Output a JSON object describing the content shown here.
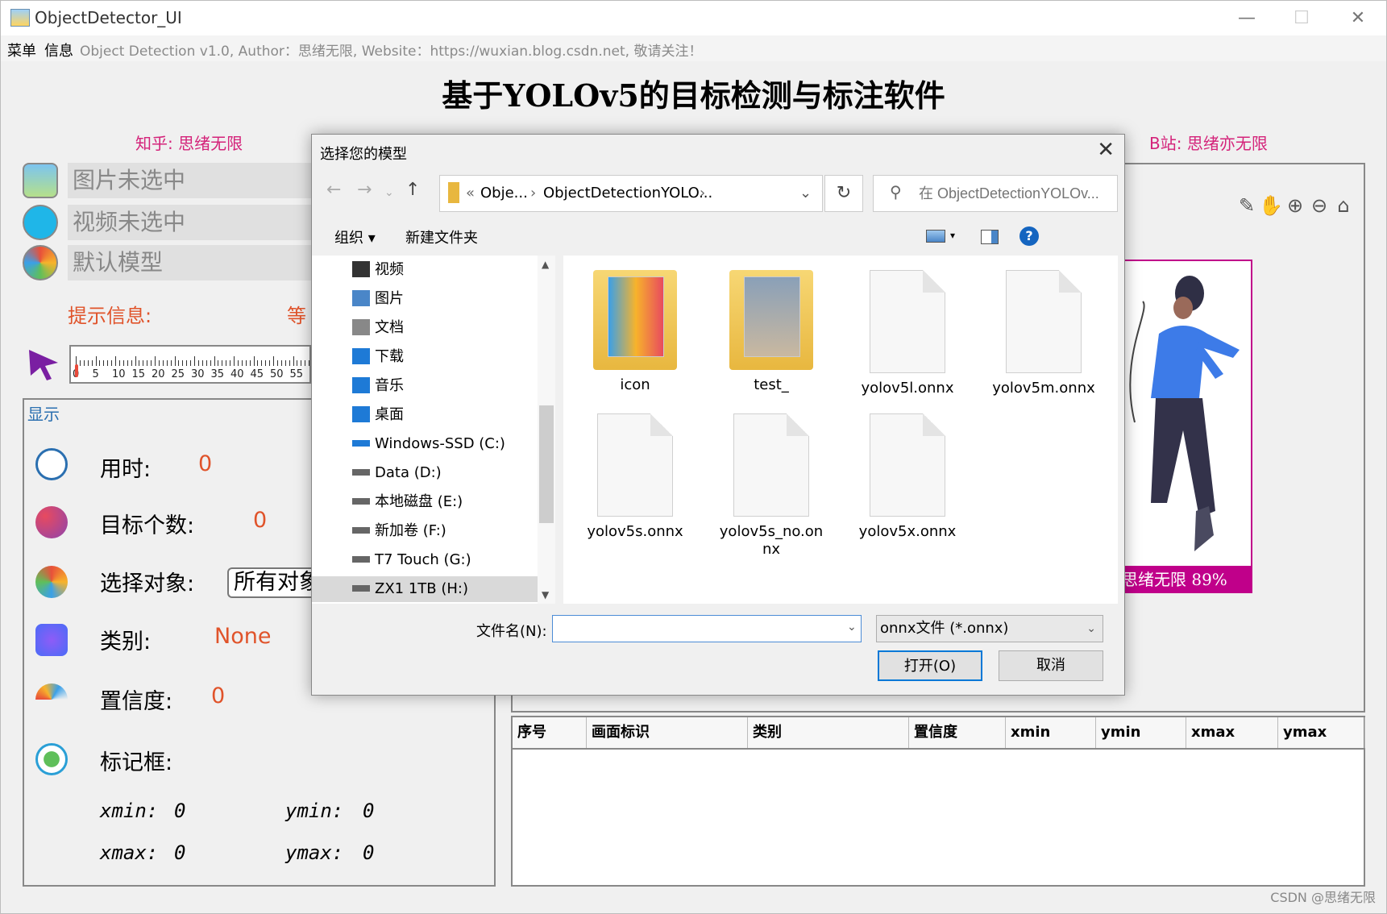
{
  "window": {
    "title": "ObjectDetector_UI",
    "controls": {
      "minimize": "—",
      "maximize": "☐",
      "close": "✕"
    }
  },
  "menubar": {
    "items": [
      "菜单",
      "信息"
    ],
    "info": "Object Detection v1.0, Author：思绪无限, Website：https://wuxian.blog.csdn.net, 敬请关注！"
  },
  "header": {
    "title": "基于YOLOv5的目标检测与标注软件",
    "zhihu": "知乎: 思绪无限",
    "bilibili": "B站: 思绪亦无限"
  },
  "left": {
    "image_status": "图片未选中",
    "video_status": "视频未选中",
    "model_status": "默认模型",
    "hint_label": "提示信息:",
    "hint_value": "等",
    "slider_ticks": [
      "0",
      "5",
      "10",
      "15",
      "20",
      "25",
      "30",
      "35",
      "40",
      "45",
      "50",
      "55"
    ],
    "display_label": "显示",
    "time_label": "用时:",
    "time_value": "0",
    "count_label": "目标个数:",
    "count_value": "0",
    "select_label": "选择对象:",
    "select_value": "所有对象",
    "class_label": "类别:",
    "class_value": "None",
    "conf_label": "置信度:",
    "conf_value": "0",
    "box_label": "标记框:",
    "xmin_label": "xmin:",
    "xmin_value": "0",
    "ymin_label": "ymin:",
    "ymin_value": "0",
    "xmax_label": "xmax:",
    "xmax_value": "0",
    "ymax_label": "ymax:",
    "ymax_value": "0"
  },
  "right": {
    "detection_label": "思绪无限  89%",
    "table_headers": [
      "序号",
      "画面标识",
      "类别",
      "置信度",
      "xmin",
      "ymin",
      "xmax",
      "ymax"
    ],
    "toolbar_icons": [
      "edit-icon",
      "hand-icon",
      "zoom-in-icon",
      "zoom-out-icon",
      "home-icon"
    ]
  },
  "dialog": {
    "title": "选择您的模型",
    "path": [
      "«",
      "Obje...",
      "›",
      "ObjectDetectionYOLO...",
      "›"
    ],
    "search_placeholder": "在 ObjectDetectionYOLOv...",
    "organize": "组织 ▾",
    "new_folder": "新建文件夹",
    "nav_items": [
      "视频",
      "图片",
      "文档",
      "下载",
      "音乐",
      "桌面",
      "Windows-SSD (C:)",
      "Data (D:)",
      "本地磁盘 (E:)",
      "新加卷 (F:)",
      "T7 Touch (G:)",
      "ZX1 1TB (H:)"
    ],
    "files": [
      {
        "name": "icon",
        "type": "folder"
      },
      {
        "name": "test_",
        "type": "folder"
      },
      {
        "name": "yolov5l.onnx",
        "type": "file"
      },
      {
        "name": "yolov5m.onnx",
        "type": "file"
      },
      {
        "name": "yolov5s.onnx",
        "type": "file"
      },
      {
        "name": "yolov5s_no.onnx",
        "type": "file"
      },
      {
        "name": "yolov5x.onnx",
        "type": "file"
      }
    ],
    "filename_label": "文件名(N):",
    "filename_value": "",
    "filetype": "onnx文件 (*.onnx)",
    "open_button": "打开(O)",
    "cancel_button": "取消"
  },
  "watermark": "CSDN @思绪无限",
  "colors": {
    "pink": "#d4237a",
    "orange": "#e0532a",
    "magenta": "#c0008a",
    "accent": "#0078d7"
  }
}
